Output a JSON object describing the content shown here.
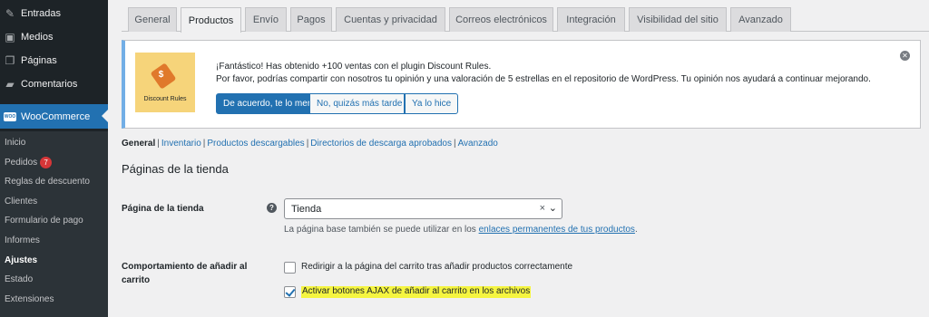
{
  "sidebar": {
    "items": [
      {
        "label": "Entradas",
        "icon": "pin-icon"
      },
      {
        "label": "Medios",
        "icon": "media-icon"
      },
      {
        "label": "Páginas",
        "icon": "pages-icon"
      },
      {
        "label": "Comentarios",
        "icon": "comments-icon"
      },
      {
        "label": "WooCommerce",
        "icon": "woocommerce-icon",
        "current": true
      }
    ],
    "woo_icon_text": "WOO",
    "submenu": [
      {
        "label": "Inicio"
      },
      {
        "label": "Pedidos",
        "badge": "7"
      },
      {
        "label": "Reglas de descuento"
      },
      {
        "label": "Clientes"
      },
      {
        "label": "Formulario de pago"
      },
      {
        "label": "Informes"
      },
      {
        "label": "Ajustes",
        "active": true
      },
      {
        "label": "Estado"
      },
      {
        "label": "Extensiones"
      }
    ]
  },
  "tabs": [
    {
      "label": "General"
    },
    {
      "label": "Productos",
      "active": true
    },
    {
      "label": "Envío"
    },
    {
      "label": "Pagos"
    },
    {
      "label": "Cuentas y privacidad"
    },
    {
      "label": "Correos electrónicos"
    },
    {
      "label": "Integración"
    },
    {
      "label": "Visibilidad del sitio"
    },
    {
      "label": "Avanzado"
    }
  ],
  "notice": {
    "logo_text": "Discount Rules",
    "line1": "¡Fantástico! Has obtenido +100 ventas con el plugin Discount Rules.",
    "line2": "Por favor, podrías compartir con nosotros tu opinión y una valoración de 5 estrellas en el repositorio de WordPress. Tu opinión nos ayudará a continuar mejorando.",
    "btn_agree": "De acuerdo, te lo mer",
    "btn_later": "No, quizás más tarde",
    "btn_done": "Ya lo hice"
  },
  "subsub": {
    "current": "General",
    "links": [
      "Inventario",
      "Productos descargables",
      "Directorios de descarga aprobados",
      "Avanzado"
    ],
    "separator": "|"
  },
  "section": {
    "title": "Páginas de la tienda"
  },
  "shop_page": {
    "label": "Página de la tienda",
    "help": "?",
    "value": "Tienda",
    "clear": "×",
    "desc_prefix": "La página base también se puede utilizar en los ",
    "desc_link": "enlaces permanentes de tus productos",
    "desc_suffix": "."
  },
  "add_to_cart": {
    "label_line1": "Comportamiento de añadir al",
    "label_line2": "carrito",
    "option1": "Redirigir a la página del carrito tras añadir productos correctamente",
    "option1_checked": false,
    "option2": "Activar botones AJAX de añadir al carrito en los archivos",
    "option2_checked": true
  }
}
